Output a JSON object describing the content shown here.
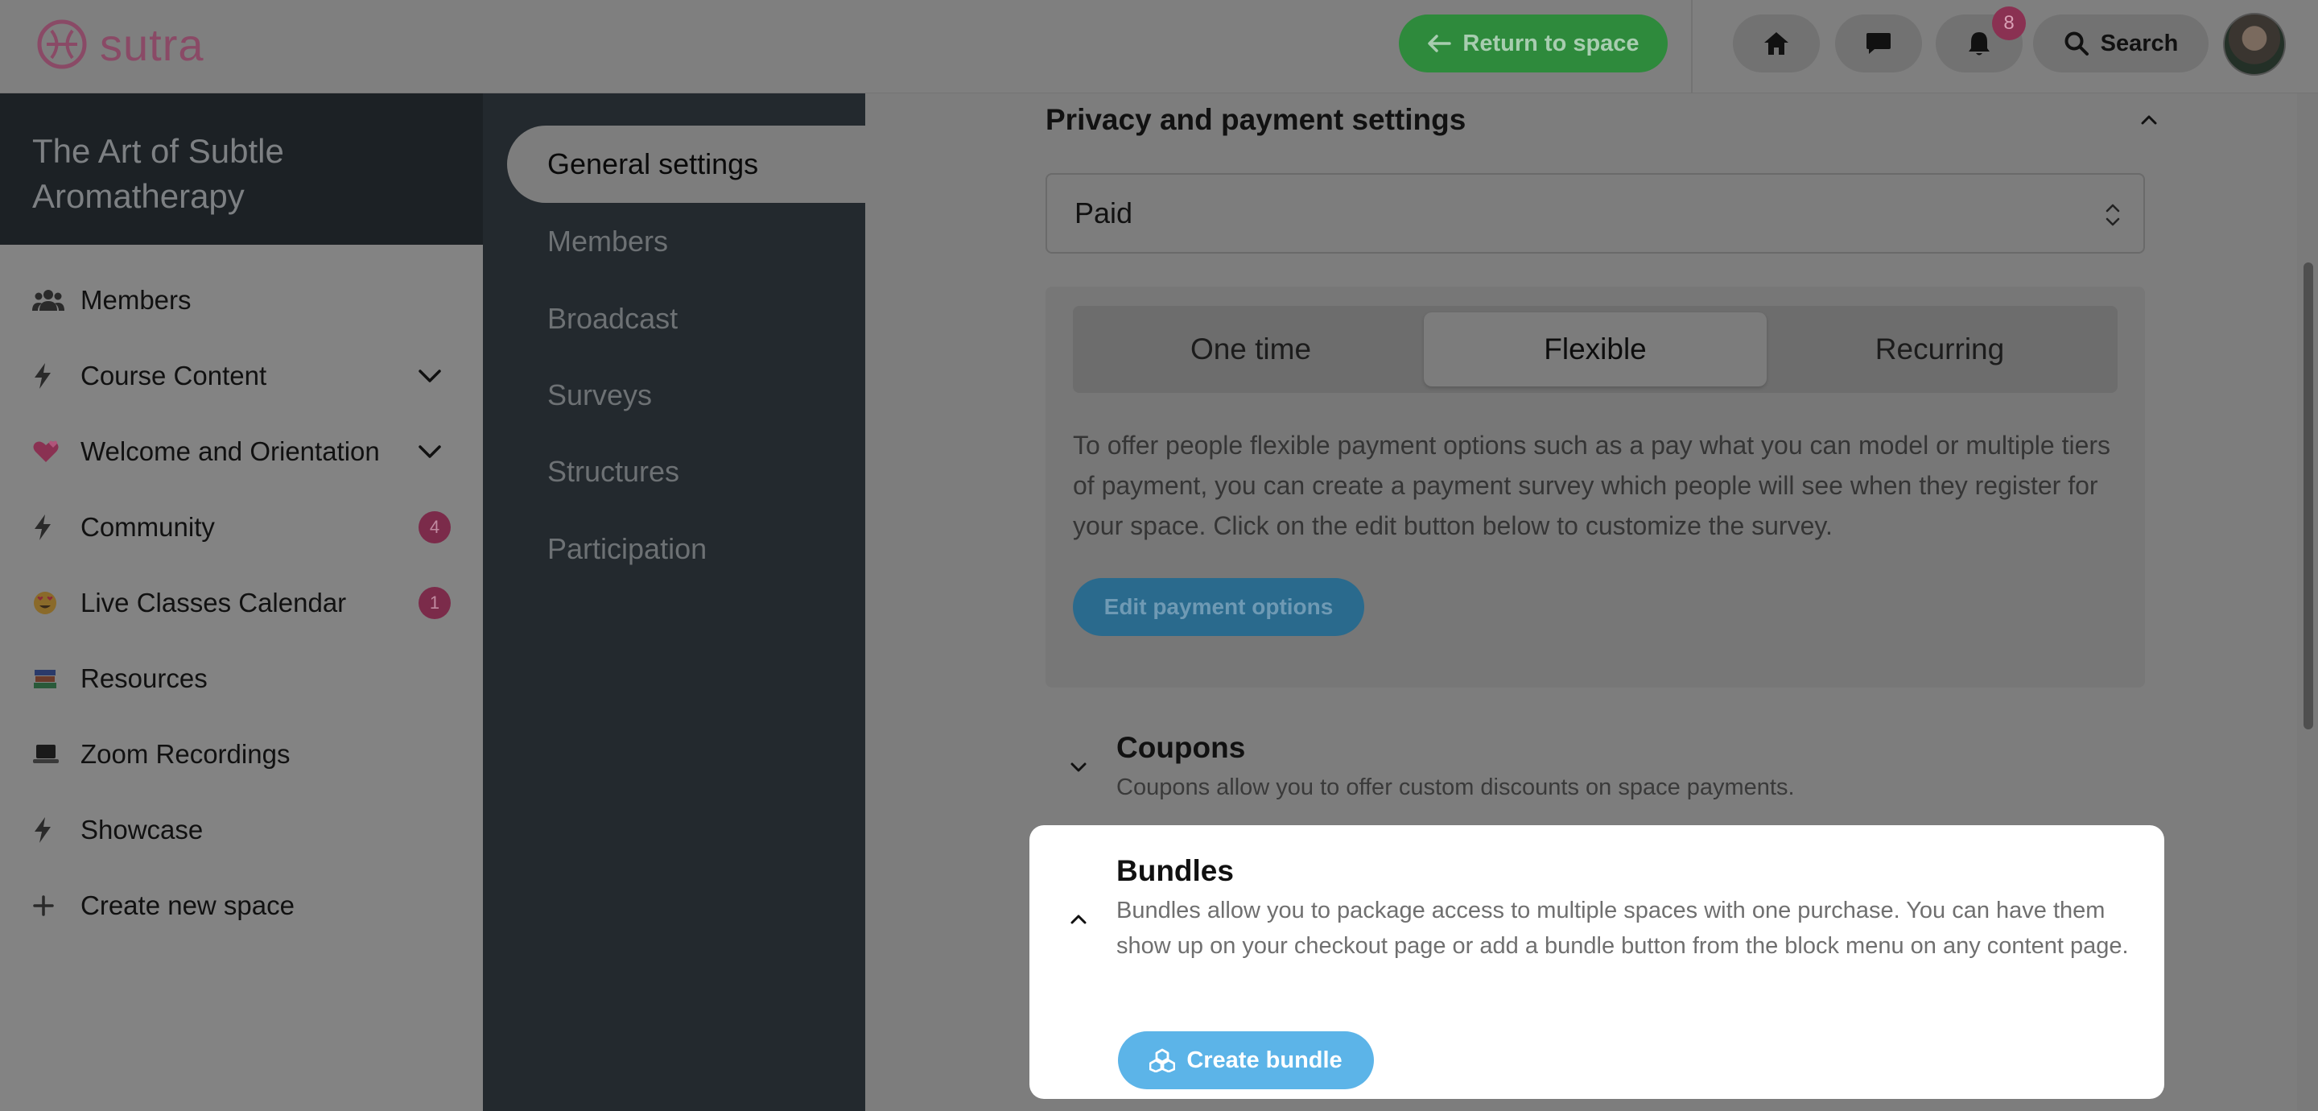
{
  "brand": {
    "logo_text": "sutra"
  },
  "topbar": {
    "return_label": "Return to space",
    "notifications_count": "8",
    "search_label": "Search"
  },
  "space": {
    "title": "The Art of Subtle Aromatherapy"
  },
  "left_nav": {
    "items": [
      {
        "label": "Members",
        "icon": "members-icon"
      },
      {
        "label": "Course Content",
        "icon": "bolt-icon"
      },
      {
        "label": "Welcome and Orientation",
        "icon": "hearts-emoji-icon"
      },
      {
        "label": "Community",
        "icon": "bolt-icon",
        "badge": "4"
      },
      {
        "label": "Live Classes Calendar",
        "icon": "heart-eyes-emoji-icon",
        "badge": "1"
      },
      {
        "label": "Resources",
        "icon": "books-emoji-icon"
      },
      {
        "label": "Zoom Recordings",
        "icon": "laptop-emoji-icon"
      },
      {
        "label": "Showcase",
        "icon": "bolt-icon"
      },
      {
        "label": "Create new space",
        "icon": "plus-icon"
      }
    ]
  },
  "settings_nav": {
    "items": [
      {
        "label": "General settings"
      },
      {
        "label": "Members"
      },
      {
        "label": "Broadcast"
      },
      {
        "label": "Surveys"
      },
      {
        "label": "Structures"
      },
      {
        "label": "Participation"
      }
    ]
  },
  "privacy": {
    "title": "Privacy and payment settings",
    "selected_option": "Paid",
    "payment_types": [
      "One time",
      "Flexible",
      "Recurring"
    ],
    "active_payment_type": "Flexible",
    "description": "To offer people flexible payment options such as a pay what you can model or multiple tiers of payment, you can create a payment survey which people will see when they register for your space. Click on the edit button below to customize the survey.",
    "edit_label": "Edit payment options"
  },
  "coupons": {
    "title": "Coupons",
    "description": "Coupons allow you to offer custom discounts on space payments."
  },
  "bundles": {
    "title": "Bundles",
    "description": "Bundles allow you to package access to multiple spaces with one purchase. You can have them show up on your checkout page or add a bundle button from the block menu on any content page.",
    "create_label": "Create bundle"
  },
  "colors": {
    "accent_green": "#2e8a3c",
    "accent_blue": "#5cb4e8",
    "badge_pink": "#8a3152",
    "dark_panel": "#23292e"
  }
}
